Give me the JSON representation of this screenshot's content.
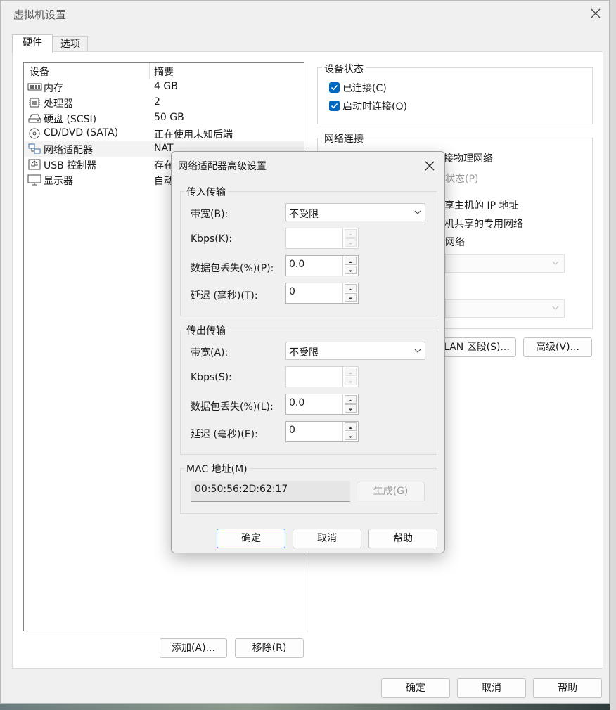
{
  "window": {
    "title": "虚拟机设置"
  },
  "tabs": [
    {
      "label": "硬件"
    },
    {
      "label": "选项"
    }
  ],
  "device_list": {
    "columns": [
      "设备",
      "摘要"
    ],
    "rows": [
      {
        "name": "内存",
        "summary": "4 GB",
        "icon": "memory-icon"
      },
      {
        "name": "处理器",
        "summary": "2",
        "icon": "cpu-icon"
      },
      {
        "name": "硬盘 (SCSI)",
        "summary": "50 GB",
        "icon": "harddisk-icon"
      },
      {
        "name": "CD/DVD (SATA)",
        "summary": "正在使用未知后端",
        "icon": "cd-icon"
      },
      {
        "name": "网络适配器",
        "summary": "NAT",
        "icon": "network-adapter-icon",
        "selected": true
      },
      {
        "name": "USB 控制器",
        "summary": "存在",
        "icon": "usb-icon"
      },
      {
        "name": "显示器",
        "summary": "自动",
        "icon": "display-icon"
      }
    ]
  },
  "device_buttons": {
    "add": "添加(A)...",
    "remove": "移除(R)"
  },
  "device_status": {
    "title": "设备状态",
    "connected": {
      "label": "已连接(C)",
      "checked": true
    },
    "connect_at_power_on": {
      "label": "启动时连接(O)",
      "checked": true
    }
  },
  "network_connection": {
    "title": "网络连接",
    "fragments": [
      "接物理网络",
      "状态(P)",
      "享主机的 IP 地址",
      "机共享的专用网络",
      "网络"
    ]
  },
  "right_buttons": {
    "lan_segments": "LAN 区段(S)...",
    "advanced": "高级(V)..."
  },
  "main_buttons": {
    "ok": "确定",
    "cancel": "取消",
    "help": "帮助"
  },
  "dialog": {
    "title": "网络适配器高级设置",
    "incoming": {
      "title": "传入传输",
      "bandwidth_label": "带宽(B):",
      "bandwidth_value": "不受限",
      "kbps_label": "Kbps(K):",
      "kbps_value": "",
      "loss_label": "数据包丢失(%)(P):",
      "loss_value": "0.0",
      "latency_label": "延迟 (毫秒)(T):",
      "latency_value": "0"
    },
    "outgoing": {
      "title": "传出传输",
      "bandwidth_label": "带宽(A):",
      "bandwidth_value": "不受限",
      "kbps_label": "Kbps(S):",
      "kbps_value": "",
      "loss_label": "数据包丢失(%)(L):",
      "loss_value": "0.0",
      "latency_label": "延迟 (毫秒)(E):",
      "latency_value": "0"
    },
    "mac": {
      "title": "MAC 地址(M)",
      "value": "00:50:56:2D:62:17",
      "generate": "生成(G)"
    },
    "buttons": {
      "ok": "确定",
      "cancel": "取消",
      "help": "帮助"
    }
  },
  "colors": {
    "accent": "#0067c0",
    "background": "#f0f0f0"
  }
}
